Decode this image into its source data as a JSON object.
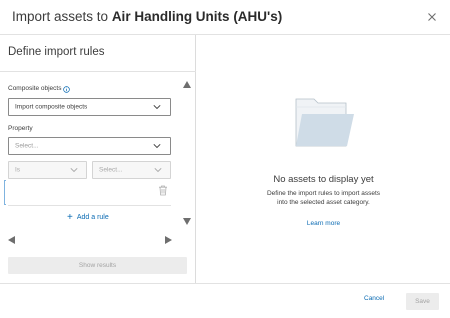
{
  "dialog": {
    "title_prefix": "Import assets to",
    "title_target": "Air Handling Units (AHU's)",
    "close_icon": "close-icon"
  },
  "left_panel": {
    "heading": "Define import rules",
    "composite": {
      "label": "Composite objects",
      "info_icon": "info-icon",
      "selected": "Import composite objects"
    },
    "property": {
      "label": "Property",
      "placeholder": "Select..."
    },
    "condition": {
      "operator": "Is",
      "value_placeholder": "Select..."
    },
    "add_rule": "Add a rule",
    "show_results": "Show results"
  },
  "right_panel": {
    "empty_title": "No assets to display yet",
    "empty_desc_line1": "Define the import rules to import assets",
    "empty_desc_line2": "into the selected asset category.",
    "learn_more": "Learn more",
    "illustration_icon": "empty-folder-icon"
  },
  "footer": {
    "cancel": "Cancel",
    "save": "Save"
  },
  "colors": {
    "link": "#0b6bb3",
    "disabled_bg": "#ececec",
    "disabled_text": "#a3a3a3",
    "folder_back": "#f0f3f6",
    "folder_front": "#cfdce7"
  }
}
